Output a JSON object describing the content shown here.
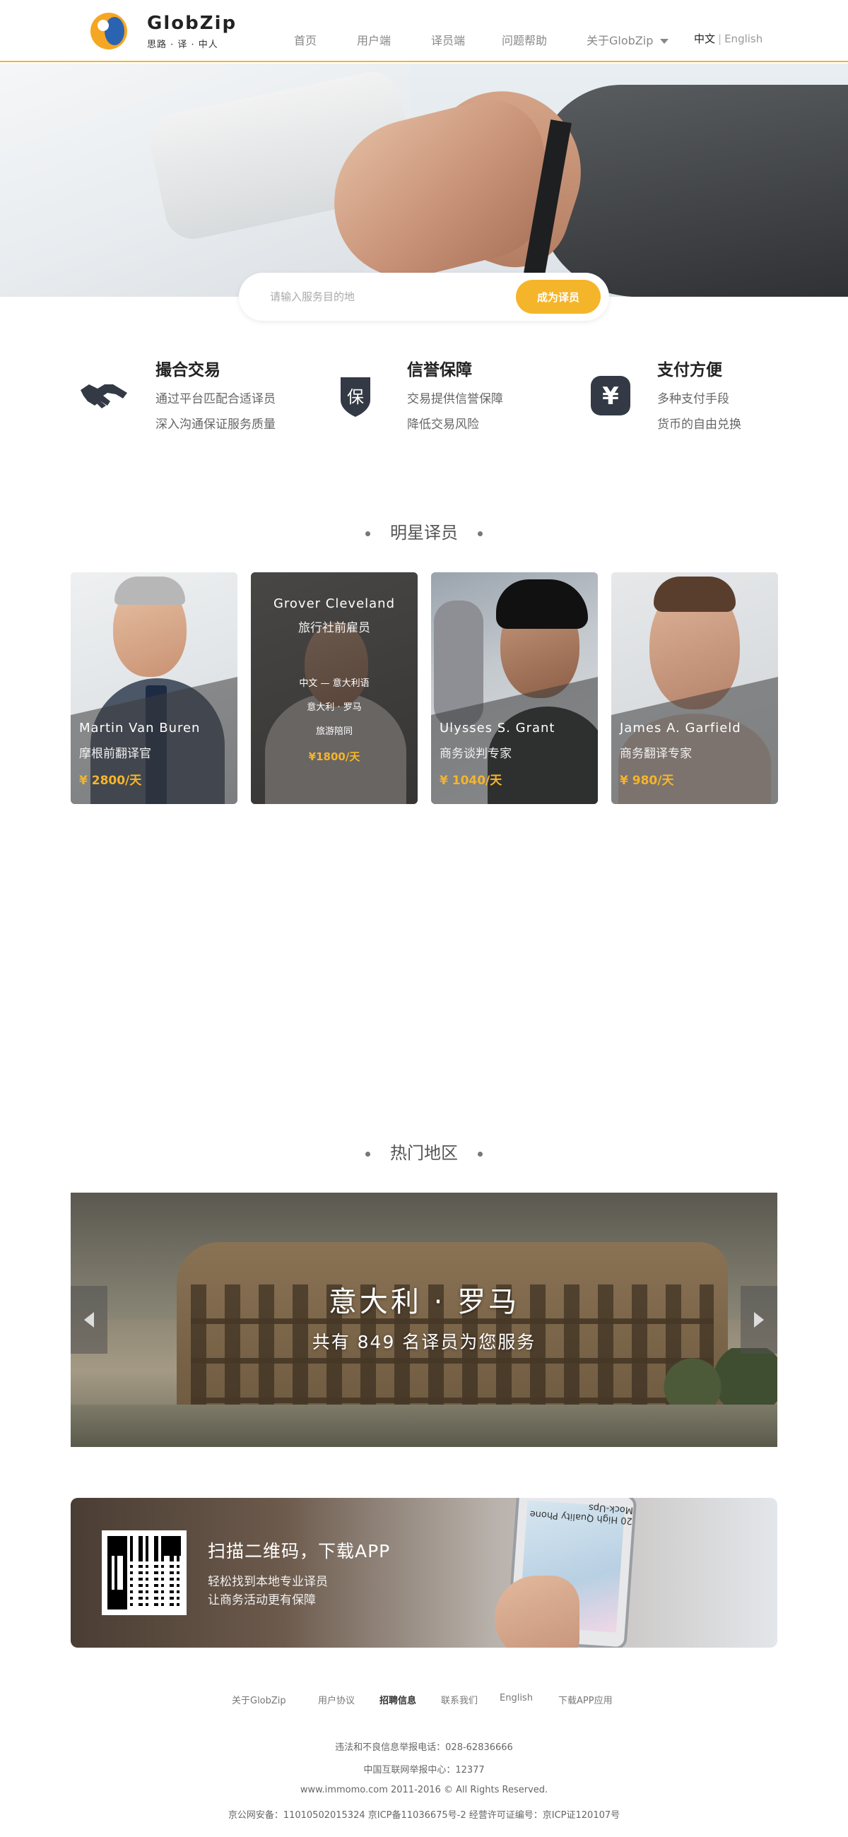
{
  "header": {
    "logo_name": "GlobZip",
    "logo_slogan": "思路 · 译 · 中人",
    "nav": [
      {
        "label": "首页"
      },
      {
        "label": "用户端"
      },
      {
        "label": "译员端"
      },
      {
        "label": "问题帮助"
      },
      {
        "label": "关于GlobZip"
      }
    ],
    "lang_current": "中文",
    "lang_sep": "|",
    "lang_alt": "English"
  },
  "search": {
    "placeholder": "请输入服务目的地",
    "button_label": "成为译员"
  },
  "features": [
    {
      "icon": "handshake-icon",
      "title": "撮合交易",
      "line1": "通过平台匹配合适译员",
      "line2": "深入沟通保证服务质量"
    },
    {
      "icon": "shield-icon",
      "icon_text": "保",
      "title": "信誉保障",
      "line1": "交易提供信誉保障",
      "line2": "降低交易风险"
    },
    {
      "icon": "yen-icon",
      "icon_text": "¥",
      "title": "支付方便",
      "line1": "多种支付手段",
      "line2": "货币的自由兑换"
    }
  ],
  "translators_section": {
    "title": "明星译员"
  },
  "translators": [
    {
      "name": "Martin Van Buren",
      "role": "摩根前翻译官",
      "price": "¥ 2800/天"
    },
    {
      "name": "Grover Cleveland",
      "role": "旅行社前雇员",
      "langs": "中文 — 意大利语",
      "city": "意大利 · 罗马",
      "category": "旅游陪同",
      "price": "¥1800/天"
    },
    {
      "name": "Ulysses S. Grant",
      "role": "商务谈判专家",
      "price": "¥ 1040/天"
    },
    {
      "name": "James A. Garfield",
      "role": "商务翻译专家",
      "price": "¥ 980/天"
    }
  ],
  "regions_section": {
    "title": "热门地区"
  },
  "region_slide": {
    "title": "意大利 · 罗马",
    "subtitle": "共有 849 名译员为您服务"
  },
  "app_banner": {
    "title": "扫描二维码，下载APP",
    "line1": "轻松找到本地专业译员",
    "line2": "让商务活动更有保障",
    "phone_text": "20 High Quality Phone Mock-Ups"
  },
  "footer": {
    "links": [
      {
        "label": "关于GlobZip"
      },
      {
        "label": "用户协议"
      },
      {
        "label": "招聘信息"
      },
      {
        "label": "联系我们"
      },
      {
        "label": "English"
      },
      {
        "label": "下载APP应用"
      }
    ],
    "report_phone": "违法和不良信息举报电话：028-62836666",
    "report_center": "中国互联网举报中心：12377",
    "copyright": "www.immomo.com 2011-2016 © All Rights Reserved.",
    "license": "京公网安备：11010502015324 京ICP备11036675号-2 经营许可证编号：京ICP证120107号"
  },
  "colors": {
    "accent": "#f5b52a",
    "text_dark": "#222222",
    "text_muted": "#888888"
  }
}
